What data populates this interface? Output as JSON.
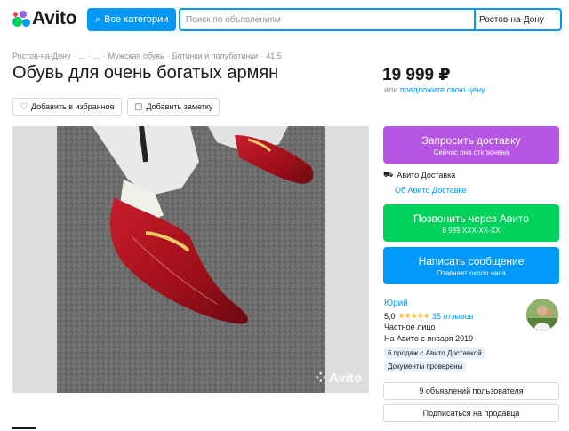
{
  "header": {
    "logo_text": "Avito",
    "categories_button": "Все категории",
    "search_placeholder": "Поиск по объявлениям",
    "city": "Ростов-на-Дону"
  },
  "breadcrumb": [
    "Ростов-на-Дону",
    "...",
    "...",
    "Мужская обувь",
    "Ботинки и полуботинки",
    "41,5"
  ],
  "listing": {
    "title": "Обувь для очень богатых армян",
    "price": "19 999 ₽",
    "offer_prefix": "или",
    "offer_link": "предложите свою цену",
    "add_favorite": "Добавить в избранное",
    "add_note": "Добавить заметку",
    "photo_watermark": "Avito"
  },
  "actions": {
    "request_delivery": "Запросить доставку",
    "request_delivery_sub": "Сейчас она отключена",
    "delivery_label": "Авито Доставка",
    "delivery_link": "Об Авито Доставке",
    "call_button": "Позвонить через Авито",
    "call_phone": "8 989 XXX-XX-XX",
    "message_button": "Написать сообщение",
    "message_sub": "Отвечает около часа"
  },
  "seller": {
    "name": "Юрий",
    "rating": "5,0",
    "stars": "★★★★★",
    "reviews": "35 отзывов",
    "type": "Частное лицо",
    "since": "На Авито с января 2019",
    "badge_sales": "6 продаж с Авито Доставкой",
    "badge_docs": "Документы проверены",
    "listings_button": "9 объявлений пользователя",
    "subscribe_button": "Подписаться на продавца"
  },
  "colors": {
    "accent_blue": "#0099f7",
    "delivery_purple": "#b657e4",
    "call_green": "#02d15c",
    "star": "#ffb021"
  }
}
